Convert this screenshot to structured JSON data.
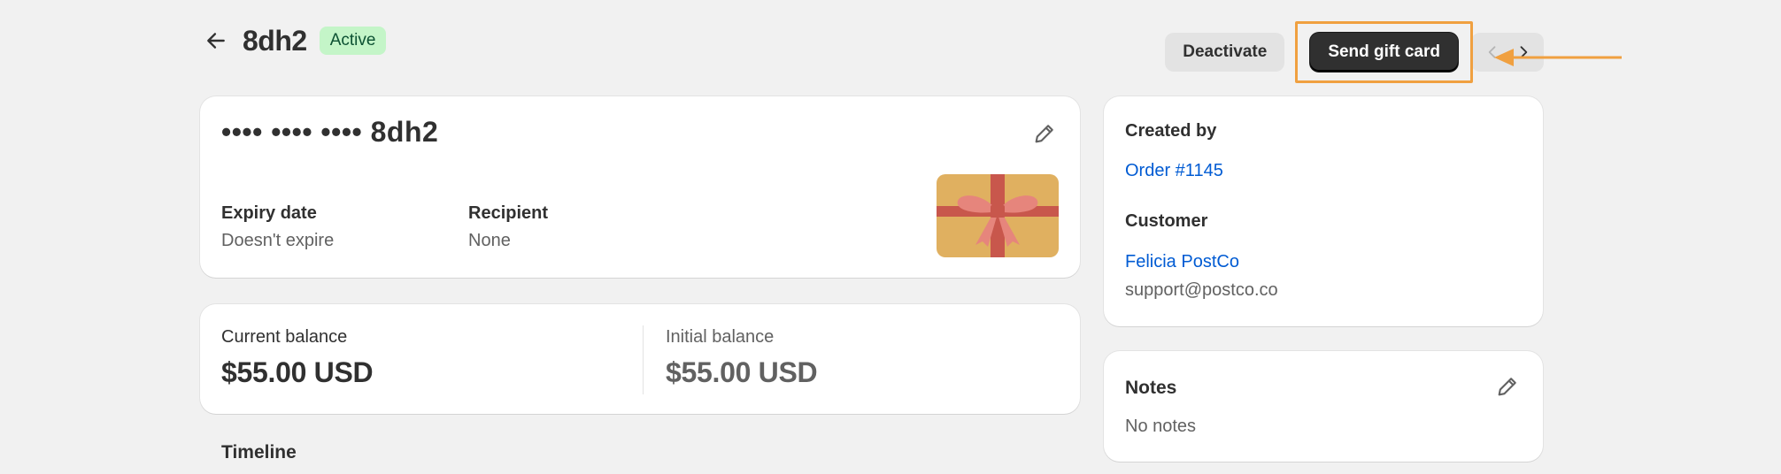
{
  "header": {
    "title": "8dh2",
    "status_badge": "Active",
    "deactivate_label": "Deactivate",
    "send_label": "Send gift card"
  },
  "gift_card": {
    "masked_code": "•••• •••• •••• 8dh2",
    "expiry_label": "Expiry date",
    "expiry_value": "Doesn't expire",
    "recipient_label": "Recipient",
    "recipient_value": "None"
  },
  "balance": {
    "current_label": "Current balance",
    "current_amount": "$55.00 USD",
    "initial_label": "Initial balance",
    "initial_amount": "$55.00 USD"
  },
  "timeline": {
    "title": "Timeline"
  },
  "created": {
    "heading": "Created by",
    "order_link": "Order #1145",
    "customer_heading": "Customer",
    "customer_name": "Felicia PostCo",
    "customer_email": "support@postco.co"
  },
  "notes": {
    "heading": "Notes",
    "value": "No notes"
  },
  "icons": {
    "back": "arrow-left-icon",
    "edit": "pencil-icon",
    "prev": "chevron-left-icon",
    "next": "chevron-right-icon",
    "gift": "gift-card-icon"
  },
  "colors": {
    "badge_bg": "#c4f5c8",
    "link": "#005bd3",
    "primary_button": "#303030",
    "annotation": "#f0a040"
  }
}
